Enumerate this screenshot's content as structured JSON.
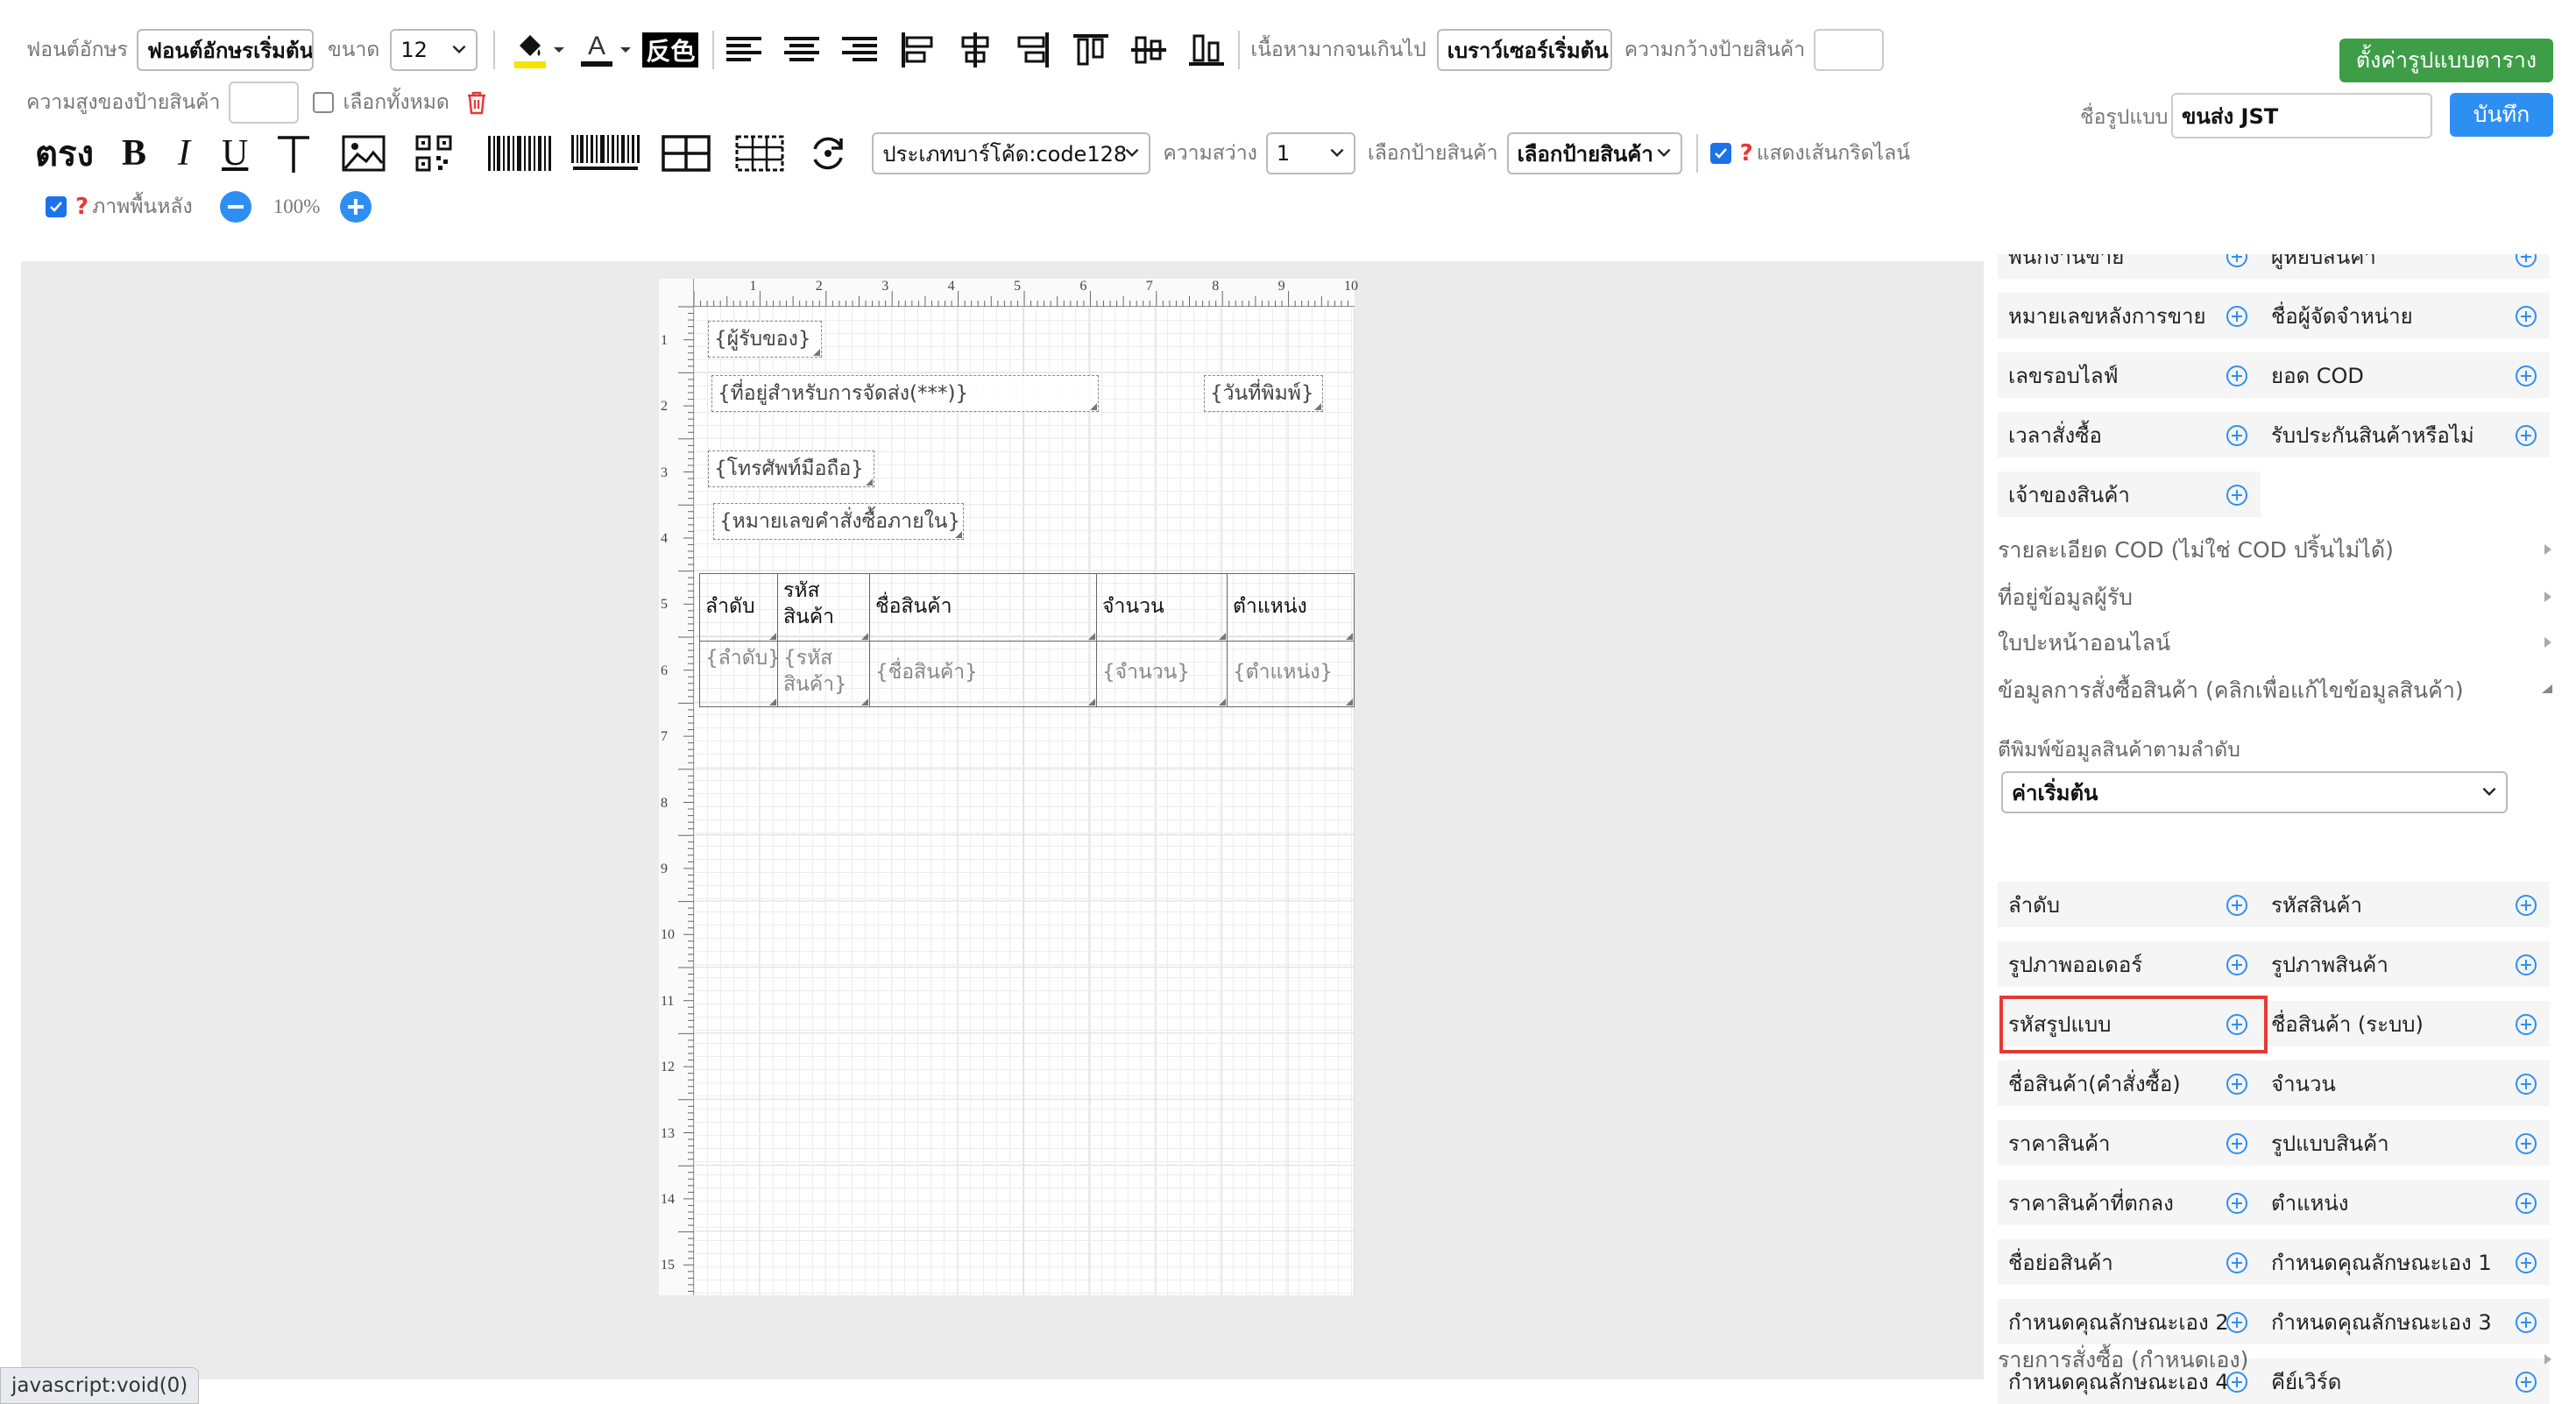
{
  "toolbar": {
    "font_label": "ฟอนต์อักษร",
    "font_value": "ฟอนต์อักษรเริ่มต้น",
    "size_label": "ขนาด",
    "size_value": "12",
    "invert_label": "反色",
    "overflow_label": "เนื้อหามากจนเกินไป",
    "overflow_value": "เบราว์เซอร์เริ่มต้น",
    "label_width_label": "ความกว้างป้ายสินค้า",
    "label_height_label": "ความสูงของป้ายสินค้า",
    "select_all_label": "เลือกทั้งหมด",
    "text_style_label": "ตรง",
    "barcode_type_value": "ประเภทบาร์โค้ด:code128",
    "brightness_label": "ความสว่าง",
    "brightness_value": "1",
    "choose_label_label": "เลือกป้ายสินค้า",
    "choose_label_value": "เลือกป้ายสินค้า",
    "show_grid_label": "แสดงเส้นกริดไลน์",
    "background_label": "ภาพพื้นหลัง",
    "zoom_value": "100%",
    "help_mark": "?",
    "set_table_button": "ตั้งค่ารูปแบบตาราง",
    "template_name_label": "ชื่อรูปแบบ",
    "template_name_value": "ขนส่ง JST",
    "save_button": "บันทึก",
    "accent_color": "#2e8ff3",
    "green_color": "#3d9e47"
  },
  "canvas": {
    "ruler_top": [
      "1",
      "2",
      "3",
      "4",
      "5",
      "6",
      "7",
      "8",
      "9",
      "10"
    ],
    "ruler_left": [
      "1",
      "2",
      "3",
      "4",
      "5",
      "6",
      "7",
      "8",
      "9",
      "10",
      "11",
      "12",
      "13",
      "14",
      "15"
    ],
    "fields": {
      "receiver": "{ผู้รับของ}",
      "address": "{ที่อยู่สำหรับการจัดส่ง(***)}",
      "print_date": "{วันที่พิมพ์}",
      "mobile": "{โทรศัพท์มือถือ}",
      "internal_order_no": "{หมายเลขคำสั่งซื้อภายใน}"
    },
    "table": {
      "headers": [
        "ลำดับ",
        "รหัสสินค้า",
        "ชื่อสินค้า",
        "จำนวน",
        "ตำแหน่ง"
      ],
      "row": [
        "{ลำดับ}",
        "{รหัสสินค้า}",
        "{ชื่อสินค้า}",
        "{จำนวน}",
        "{ตำแหน่ง}"
      ]
    }
  },
  "panel": {
    "top_items": [
      [
        "พนักงานขาย",
        "ผู้หยิบสินค้า"
      ],
      [
        "หมายเลขหลังการขาย",
        "ชื่อผู้จัดจำหน่าย"
      ],
      [
        "เลขรอบไลฟ์",
        "ยอด COD"
      ],
      [
        "เวลาสั่งซื้อ",
        "รับประกันสินค้าหรือไม่"
      ],
      [
        "เจ้าของสินค้า",
        ""
      ]
    ],
    "sections": [
      "รายละเอียด COD (ไม่ใช่ COD ปริ้นไม่ได้)",
      "ที่อยู่ข้อมูลผู้รับ",
      "ใบปะหน้าออนไลน์",
      "ข้อมูลการสั่งซื้อสินค้า (คลิกเพื่อแก้ไขข้อมูลสินค้า)"
    ],
    "print_order_label": "ตีพิมพ์ข้อมูลสินค้าตามลำดับ",
    "print_order_value": "ค่าเริ่มต้น",
    "items": [
      [
        "ลำดับ",
        "รหัสสินค้า"
      ],
      [
        "รูปภาพออเดอร์",
        "รูปภาพสินค้า"
      ],
      [
        "รหัสรูปแบบ",
        "ชื่อสินค้า (ระบบ)"
      ],
      [
        "ชื่อสินค้า(คำสั่งซื้อ)",
        "จำนวน"
      ],
      [
        "ราคาสินค้า",
        "รูปแบบสินค้า"
      ],
      [
        "ราคาสินค้าที่ตกลง",
        "ตำแหน่ง"
      ],
      [
        "ชื่อย่อสินค้า",
        "กำหนดคุณลักษณะเอง 1"
      ],
      [
        "กำหนดคุณลักษณะเอง 2",
        "กำหนดคุณลักษณะเอง 3"
      ],
      [
        "กำหนดคุณลักษณะเอง 4",
        "คีย์เวิร์ด"
      ]
    ],
    "highlighted_item": "ชื่อสินค้า(คำสั่งซื้อ)",
    "bottom_section": "รายการสั่งซื้อ (กำหนดเอง)",
    "highlight_color": "#e53935"
  },
  "status_bar": "javascript:void(0)"
}
